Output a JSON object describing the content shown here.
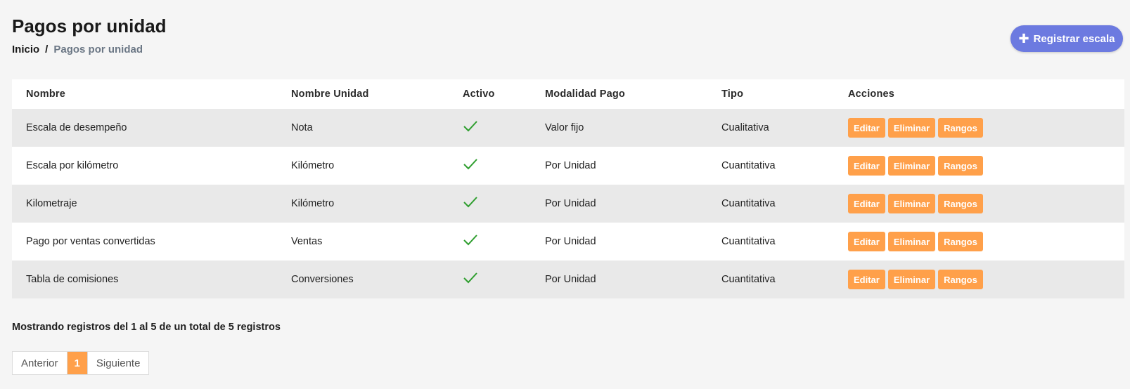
{
  "header": {
    "title": "Pagos por unidad",
    "breadcrumb": {
      "home": "Inicio",
      "separator": "/",
      "current": "Pagos por unidad"
    },
    "register_button": {
      "icon": "plus-icon",
      "label": "Registrar escala",
      "color": "#6c7ae0"
    }
  },
  "table": {
    "columns": [
      "Nombre",
      "Nombre Unidad",
      "Activo",
      "Modalidad Pago",
      "Tipo",
      "Acciones"
    ],
    "rows": [
      {
        "nombre": "Escala de desempeño",
        "unidad": "Nota",
        "activo": true,
        "modalidad": "Valor fijo",
        "tipo": "Cualitativa"
      },
      {
        "nombre": "Escala por kilómetro",
        "unidad": "Kilómetro",
        "activo": true,
        "modalidad": "Por Unidad",
        "tipo": "Cuantitativa"
      },
      {
        "nombre": "Kilometraje",
        "unidad": "Kilómetro",
        "activo": true,
        "modalidad": "Por Unidad",
        "tipo": "Cuantitativa"
      },
      {
        "nombre": "Pago por ventas convertidas",
        "unidad": "Ventas",
        "activo": true,
        "modalidad": "Por Unidad",
        "tipo": "Cuantitativa"
      },
      {
        "nombre": "Tabla de comisiones",
        "unidad": "Conversiones",
        "activo": true,
        "modalidad": "Por Unidad",
        "tipo": "Cuantitativa"
      }
    ],
    "actions": {
      "edit": "Editar",
      "delete": "Eliminar",
      "ranges": "Rangos"
    },
    "action_color": "#ffa04a",
    "check_color": "#2e9e2e"
  },
  "footer": {
    "info": "Mostrando registros del 1 al 5 de un total de 5 registros",
    "pagination": {
      "prev": "Anterior",
      "current_page": "1",
      "next": "Siguiente"
    }
  }
}
